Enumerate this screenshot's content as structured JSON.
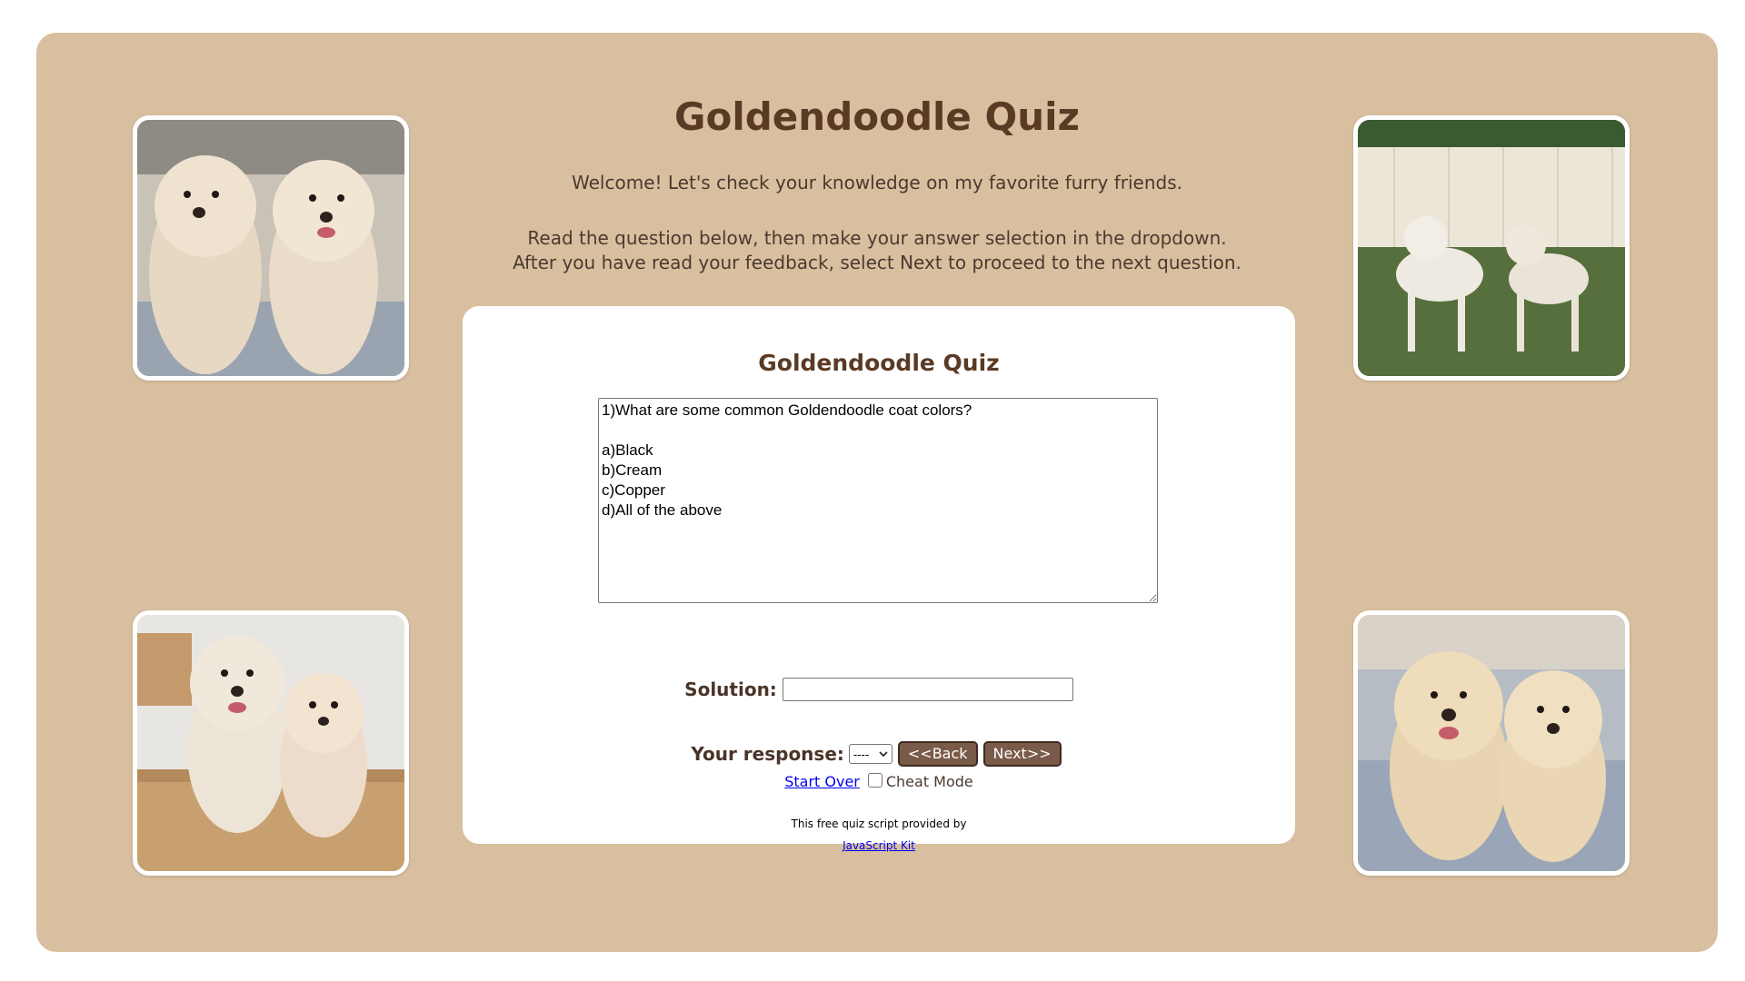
{
  "page": {
    "title": "Goldendoodle Quiz",
    "intro_line_1": "Welcome! Let's check your knowledge on my favorite furry friends.",
    "intro_line_2": "Read the question below, then make your answer selection in the dropdown.",
    "intro_line_3": "After you have read your feedback, select Next to proceed to the next question."
  },
  "colors": {
    "background": "#d8bf9f",
    "title": "#5a3a24",
    "button": "#7a5a48",
    "card": "#ffffff"
  },
  "photos": [
    {
      "icon": "photo-two-cream-doodles-on-couch"
    },
    {
      "icon": "photo-two-shaved-doodles-in-yard"
    },
    {
      "icon": "photo-two-doodles-in-cardboard-box"
    },
    {
      "icon": "photo-two-doodles-on-rug"
    }
  ],
  "quiz": {
    "title": "Goldendoodle Quiz",
    "question_text": "1)What are some common Goldendoodle coat colors?\n\na)Black\nb)Cream\nc)Copper\nd)All of the above",
    "solution_label": "Solution:",
    "solution_value": "",
    "response_label": "Your response:",
    "response_selected": "----",
    "back_label": "<<Back",
    "next_label": "Next>>",
    "start_over_label": "Start Over",
    "cheat_mode_label": "Cheat Mode",
    "cheat_mode_checked": false,
    "credit_text": "This free quiz script provided by",
    "credit_link": "JavaScript Kit"
  }
}
